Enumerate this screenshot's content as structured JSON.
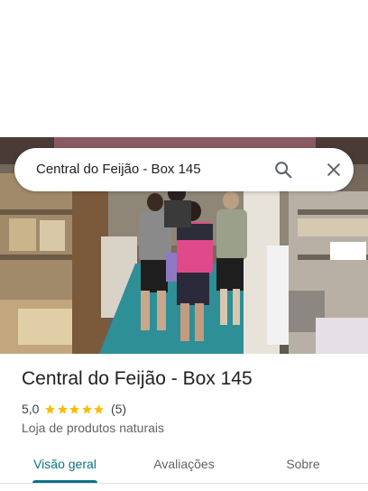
{
  "search": {
    "query": "Central do Feijão - Box 145",
    "search_icon": "search-icon",
    "close_icon": "close-icon"
  },
  "place": {
    "name": "Central do Feijão - Box 145",
    "rating": "5,0",
    "stars": 5,
    "review_count": "(5)",
    "category": "Loja de produtos naturais"
  },
  "tabs": [
    {
      "label": "Visão geral",
      "active": true
    },
    {
      "label": "Avaliações",
      "active": false
    },
    {
      "label": "Sobre",
      "active": false
    }
  ],
  "colors": {
    "accent": "#0b7285",
    "star": "#fbbc04",
    "text": "#202124",
    "secondary_text": "#5f6368"
  }
}
